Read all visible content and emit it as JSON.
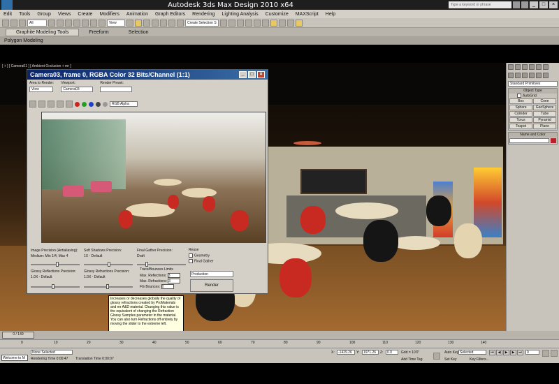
{
  "window": {
    "title": "Autodesk 3ds Max Design 2010 x64",
    "search_placeholder": "Type a keyword or phrase",
    "min": "_",
    "max": "□",
    "close": "×"
  },
  "menu": [
    "Edit",
    "Tools",
    "Group",
    "Views",
    "Create",
    "Modifiers",
    "Animation",
    "Graph Editors",
    "Rendering",
    "Lighting Analysis",
    "Customize",
    "MAXScript",
    "Help"
  ],
  "toolbar": {
    "selection_filter": "All",
    "view_dropdown": "View",
    "selection_set": "Create Selection S"
  },
  "ribbon": {
    "tabs": [
      "Graphite Modeling Tools",
      "Freeform",
      "Selection"
    ],
    "active_tab": "Graphite Modeling Tools",
    "sub_label": "Polygon Modeling"
  },
  "viewport": {
    "label": "[ + ] [ Camera01 ] [ Ambient Occlusion + mr ]"
  },
  "render_window": {
    "title": "Camera03, frame 0, RGBA Color 32 Bits/Channel (1:1)",
    "area_label": "Area to Render:",
    "area_value": "View",
    "viewport_label": "Viewport:",
    "viewport_value": "Camera03",
    "preset_label": "Render Preset:",
    "preset_value": "",
    "channel_value": "RGB Alpha",
    "image_precision_label": "Image Precision (Antialiasing):",
    "image_precision_value": "Medium: Min 1/4, Max 4",
    "soft_shadows_label": "Soft Shadows Precision:",
    "soft_shadows_value": "1X - Default",
    "final_gather_label": "Final Gather Precision:",
    "final_gather_value": "Draft",
    "glossy_reflections_label": "Glossy Reflections Precision:",
    "glossy_reflections_value": "1.0X - Default",
    "glossy_refractions_label": "Glossy Refractions Precision:",
    "glossy_refractions_value": "1.0X - Default",
    "reuse_label": "Reuse",
    "geometry_label": "Geometry",
    "final_gather_check": "Final Gather",
    "trace_limits_label": "Trace/Bounces Limits",
    "max_reflections_label": "Max. Reflections:",
    "max_reflections_value": "3",
    "max_refractions_label": "Max. Refractions:",
    "max_refractions_value": "3",
    "fg_bounces_label": "FG Bounces:",
    "fg_bounces_value": "0",
    "mode_value": "Production",
    "render_button": "Render"
  },
  "tooltip": "Increases or decreases globally the quality of glossy refractions created by ProMaterials and mr A&D material. Changing this value is the equivalent of changing the Refraction Glossy Samples parameter in the material. You can also turn Refractions off entirely by moving the slider to the extreme left.",
  "command_panel": {
    "category": "Standard Primitives",
    "object_type_header": "Object Type",
    "autogrid": "AutoGrid",
    "buttons": [
      "Box",
      "Cone",
      "Sphere",
      "GeoSphere",
      "Cylinder",
      "Tube",
      "Torus",
      "Pyramid",
      "Teapot",
      "Plane"
    ],
    "name_color_header": "Name and Color",
    "color": "#b8202a"
  },
  "timeline": {
    "slider": "0 / 149",
    "ticks": [
      "0",
      "10",
      "20",
      "30",
      "40",
      "50",
      "60",
      "70",
      "80",
      "90",
      "100",
      "110",
      "120",
      "130",
      "140"
    ]
  },
  "status": {
    "welcome": "Welcome to M",
    "selection": "None Selected",
    "rendering_time": "Rendering Time  0:00:47",
    "translation_time": "Translation Time  0:00:07",
    "x_label": "X:",
    "x_value": "-1429.26",
    "y_label": "Y:",
    "y_value": "1971.26",
    "z_label": "Z:",
    "z_value": "0.0",
    "grid": "Grid = 10'0\"",
    "auto_key": "Auto Key",
    "auto_key_mode": "Selected",
    "set_key": "Set Key",
    "key_filters": "Key Filters...",
    "add_time_tag": "Add Time Tag",
    "frame": "0"
  }
}
